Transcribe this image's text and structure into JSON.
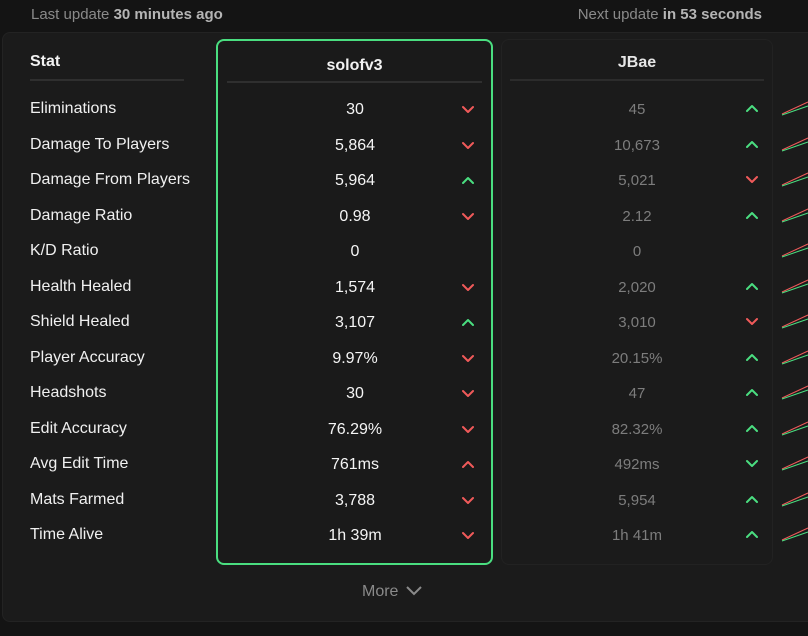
{
  "header": {
    "last_update_prefix": "Last update",
    "last_update_value": "30 minutes ago",
    "next_update_prefix": "Next update",
    "next_update_value": "in 53 seconds"
  },
  "table": {
    "stat_header": "Stat",
    "player1": "solofv3",
    "player2": "JBae",
    "rows": [
      {
        "label": "Eliminations",
        "p1": "30",
        "p1_trend": "down",
        "p2": "45",
        "p2_trend": "up"
      },
      {
        "label": "Damage To Players",
        "p1": "5,864",
        "p1_trend": "down",
        "p2": "10,673",
        "p2_trend": "up"
      },
      {
        "label": "Damage From Players",
        "p1": "5,964",
        "p1_trend": "up",
        "p2": "5,021",
        "p2_trend": "down"
      },
      {
        "label": "Damage Ratio",
        "p1": "0.98",
        "p1_trend": "down",
        "p2": "2.12",
        "p2_trend": "up"
      },
      {
        "label": "K/D Ratio",
        "p1": "0",
        "p1_trend": "none",
        "p2": "0",
        "p2_trend": "none"
      },
      {
        "label": "Health Healed",
        "p1": "1,574",
        "p1_trend": "down",
        "p2": "2,020",
        "p2_trend": "up"
      },
      {
        "label": "Shield Healed",
        "p1": "3,107",
        "p1_trend": "up",
        "p2": "3,010",
        "p2_trend": "down"
      },
      {
        "label": "Player Accuracy",
        "p1": "9.97%",
        "p1_trend": "down",
        "p2": "20.15%",
        "p2_trend": "up"
      },
      {
        "label": "Headshots",
        "p1": "30",
        "p1_trend": "down",
        "p2": "47",
        "p2_trend": "up"
      },
      {
        "label": "Edit Accuracy",
        "p1": "76.29%",
        "p1_trend": "down",
        "p2": "82.32%",
        "p2_trend": "up"
      },
      {
        "label": "Avg Edit Time",
        "p1": "761ms",
        "p1_trend": "up_bad",
        "p2": "492ms",
        "p2_trend": "down_good"
      },
      {
        "label": "Mats Farmed",
        "p1": "3,788",
        "p1_trend": "down",
        "p2": "5,954",
        "p2_trend": "up"
      },
      {
        "label": "Time Alive",
        "p1": "1h 39m",
        "p1_trend": "down",
        "p2": "1h 41m",
        "p2_trend": "up"
      }
    ]
  },
  "more_label": "More",
  "colors": {
    "good": "#4ade80",
    "bad": "#f05a5a",
    "accent_border": "#4ade80"
  },
  "icons": {
    "up": "chevron-up-icon",
    "down": "chevron-down-icon",
    "more": "chevron-down-icon"
  }
}
